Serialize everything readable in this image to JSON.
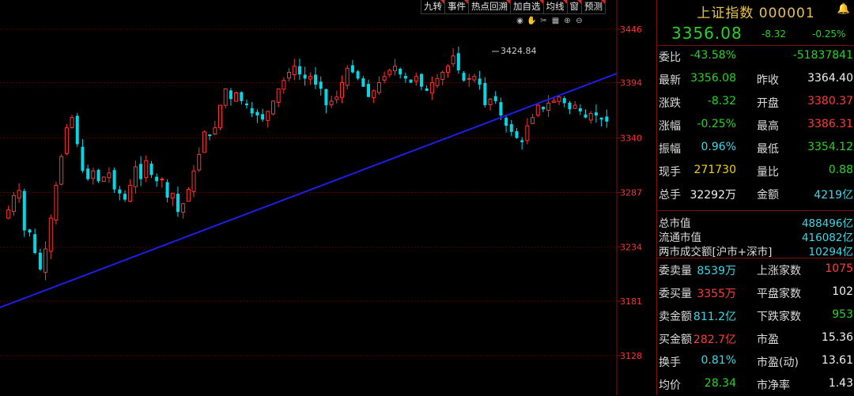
{
  "toolbar": {
    "buttons": [
      "九转",
      "事件",
      "热点回溯",
      "加自选",
      "均线",
      "窗",
      "预测"
    ],
    "icons": [
      "eye-icon",
      "hand-icon",
      "scissors-icon",
      "grid-icon",
      "zoom-in-icon",
      "zoom-out-icon"
    ]
  },
  "chart_data": {
    "type": "candlestick",
    "y_ticks": [
      "3446",
      "3394",
      "3340",
      "3287",
      "3234",
      "3181",
      "3128"
    ],
    "ylim": [
      3100,
      3465
    ],
    "annotation": "3424.84",
    "colors": {
      "up": "#ff3333",
      "down": "#00d8e8",
      "trendline": "#1e1ee8",
      "grid": "#5a0000",
      "tick": "#ff3333"
    },
    "close_path": [
      3262,
      3270,
      3284,
      3289,
      3250,
      3248,
      3228,
      3212,
      3232,
      3262,
      3294,
      3322,
      3350,
      3360,
      3334,
      3308,
      3300,
      3308,
      3298,
      3302,
      3306,
      3290,
      3286,
      3280,
      3294,
      3312,
      3300,
      3318,
      3304,
      3298,
      3300,
      3282,
      3286,
      3268,
      3276,
      3290,
      3308,
      3324,
      3346,
      3342,
      3350,
      3372,
      3388,
      3378,
      3384,
      3376,
      3372,
      3364,
      3362,
      3358,
      3366,
      3376,
      3388,
      3396,
      3404,
      3410,
      3402,
      3398,
      3400,
      3392,
      3388,
      3372,
      3376,
      3380,
      3394,
      3408,
      3404,
      3398,
      3390,
      3380,
      3386,
      3394,
      3400,
      3406,
      3410,
      3402,
      3398,
      3394,
      3400,
      3390,
      3386,
      3394,
      3398,
      3404,
      3410,
      3420,
      3406,
      3396,
      3398,
      3400,
      3392,
      3372,
      3378,
      3376,
      3362,
      3352,
      3346,
      3340,
      3336,
      3352,
      3360,
      3372,
      3368,
      3374,
      3376,
      3380,
      3374,
      3368,
      3372,
      3366,
      3360,
      3364,
      3362,
      3358,
      3356
    ]
  },
  "panel": {
    "title": "上证指数 000001",
    "price": "3356.08",
    "change": "-8.32",
    "change_pct": "-0.25%",
    "rows": [
      {
        "l1": "委比",
        "v1": "-43.58%",
        "c1": "dn",
        "l2": "",
        "v2": "-51837841",
        "c2": "dn"
      },
      {
        "l1": "最新",
        "v1": "3356.08",
        "c1": "dn",
        "l2": "昨收",
        "v2": "3364.40",
        "c2": "wh"
      },
      {
        "l1": "涨跌",
        "v1": "-8.32",
        "c1": "dn",
        "l2": "开盘",
        "v2": "3380.37",
        "c2": "up"
      },
      {
        "l1": "涨幅",
        "v1": "-0.25%",
        "c1": "dn",
        "l2": "最高",
        "v2": "3386.31",
        "c2": "up"
      },
      {
        "l1": "振幅",
        "v1": "0.96%",
        "c1": "cy",
        "l2": "最低",
        "v2": "3354.12",
        "c2": "dn"
      },
      {
        "l1": "现手",
        "v1": "271730",
        "c1": "yl",
        "l2": "量比",
        "v2": "0.88",
        "c2": "dn"
      },
      {
        "l1": "总手",
        "v1": "32292万",
        "c1": "wh",
        "l2": "金额",
        "v2": "4219亿",
        "c2": "cy"
      }
    ],
    "market": [
      {
        "l": "总市值",
        "v": "488496亿"
      },
      {
        "l": "流通市值",
        "v": "416082亿"
      },
      {
        "l": "两市成交额[沪市+深市]",
        "v": "10294亿"
      }
    ],
    "rows2": [
      {
        "l1": "委卖量",
        "v1": "8539万",
        "c1": "cy",
        "l2": "上涨家数",
        "v2": "1075",
        "c2": "up"
      },
      {
        "l1": "委买量",
        "v1": "3355万",
        "c1": "up",
        "l2": "平盘家数",
        "v2": "102",
        "c2": "wh"
      },
      {
        "l1": "卖金额",
        "v1": "811.2亿",
        "c1": "cy",
        "l2": "下跌家数",
        "v2": "953",
        "c2": "dn"
      },
      {
        "l1": "买金额",
        "v1": "282.7亿",
        "c1": "up",
        "l2": "市盈",
        "v2": "15.36",
        "c2": "wh"
      },
      {
        "l1": "换手",
        "v1": "0.81%",
        "c1": "cy",
        "l2": "市盈(动)",
        "v2": "13.61",
        "c2": "wh"
      },
      {
        "l1": "均价",
        "v1": "28.34",
        "c1": "dn",
        "l2": "市净率",
        "v2": "1.43",
        "c2": "wh"
      }
    ]
  }
}
